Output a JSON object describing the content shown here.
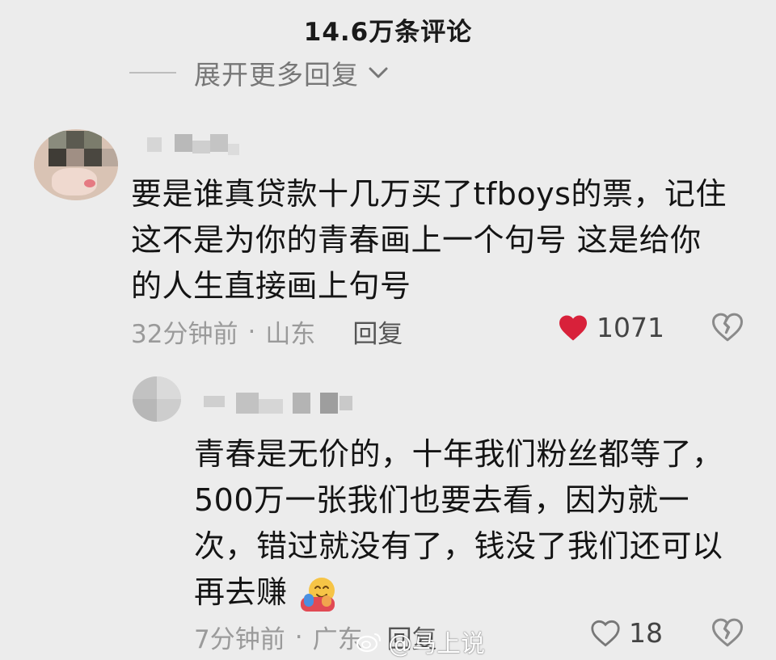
{
  "header": {
    "comment_count": "14.6万条评论"
  },
  "expand": {
    "label": "展开更多回复"
  },
  "comments": [
    {
      "lines": [
        "要是谁真贷款十几万买了tfboys的票，记住",
        "这不是为你的青春画上一个句号 这是给你",
        "的人生直接画上句号"
      ],
      "time": "32分钟前",
      "location": "山东",
      "reply_label": "回复",
      "likes": "1071"
    },
    {
      "lines": [
        "青春是无价的，十年我们粉丝都等了，",
        "500万一张我们也要去看，因为就一",
        "次，错过就没有了，钱没了我们还可以",
        "再去赚"
      ],
      "time": "7分钟前",
      "location": "广东",
      "reply_label": "回复",
      "likes": "18"
    }
  ],
  "watermark": {
    "text": "@马上说"
  },
  "colors": {
    "like_active": "#d8213a",
    "muted": "#9a9a9a"
  }
}
